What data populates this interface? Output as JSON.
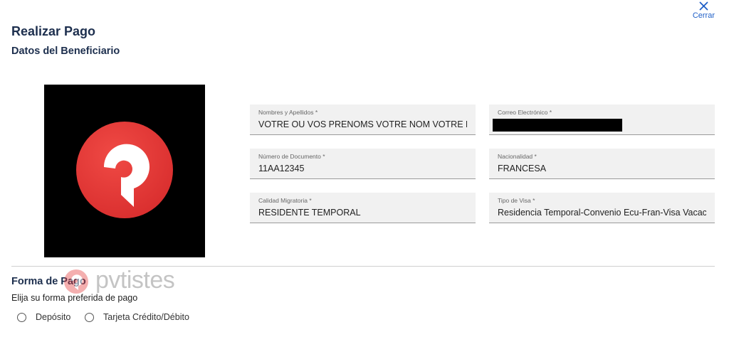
{
  "header": {
    "close_label": "Cerrar",
    "close_icon": "close-icon",
    "title": "Realizar Pago",
    "subtitle": "Datos del Beneficiario"
  },
  "photo": {
    "description_icon": "pvtistes-logo",
    "colors": {
      "background": "#000000",
      "circle": "#e53a3a",
      "mark": "#ffffff"
    }
  },
  "fields": [
    {
      "label": "Nombres y Apellidos *",
      "value": "VOTRE OU VOS PRENOMS VOTRE NOM VOTRE DE"
    },
    {
      "label": "Correo Electrónico *",
      "value": ""
    },
    {
      "label": "Número de Documento *",
      "value": "11AA12345"
    },
    {
      "label": "Nacionalidad *",
      "value": "FRANCESA"
    },
    {
      "label": "Calidad Migratoria *",
      "value": "RESIDENTE TEMPORAL"
    },
    {
      "label": "Tipo de Visa *",
      "value": "Residencia Temporal-Convenio Ecu-Fran-Visa Vacaci"
    }
  ],
  "payment": {
    "title": "Forma de Pago",
    "subtitle": "Elija su forma preferida de pago",
    "options": [
      {
        "label": "Depósito",
        "selected": false
      },
      {
        "label": "Tarjeta Crédito/Débito",
        "selected": false
      }
    ]
  },
  "watermark": {
    "text": "pvtistes"
  },
  "colors": {
    "heading": "#1d2f4e",
    "link": "#1f5fc7",
    "field_bg": "#f1f1f1",
    "brand_red": "#e53a3a"
  }
}
